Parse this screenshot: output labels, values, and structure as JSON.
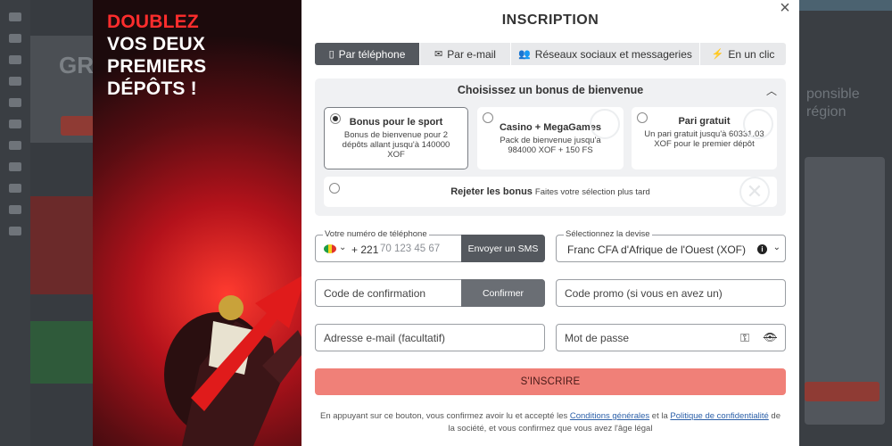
{
  "background": {
    "left_text": "GR",
    "right_text": "ponsible région"
  },
  "promo": {
    "highlight": "DOUBLEZ",
    "rest": "VOS DEUX\nPREMIERS\nDÉPÔTS !"
  },
  "modal": {
    "title": "INSCRIPTION",
    "close_icon": "close-icon"
  },
  "tabs": [
    {
      "label": "Par téléphone",
      "icon": "phone-icon",
      "active": true
    },
    {
      "label": "Par e-mail",
      "icon": "envelope-icon",
      "active": false
    },
    {
      "label": "Réseaux sociaux et messageries",
      "icon": "users-icon",
      "active": false
    },
    {
      "label": "En un clic",
      "icon": "bolt-icon",
      "active": false
    }
  ],
  "bonus": {
    "heading": "Choisissez un bonus de bienvenue",
    "options": [
      {
        "title": "Bonus pour le sport",
        "desc": "Bonus de bienvenue pour 2 dépôts allant jusqu'à 140000 XOF",
        "selected": true
      },
      {
        "title": "Casino + MegaGames",
        "desc": "Pack de bienvenue jusqu'à 984000 XOF + 150 FS",
        "selected": false
      },
      {
        "title": "Pari gratuit",
        "desc": "Un pari gratuit jusqu'à 60331.03 XOF pour le premier dépôt",
        "selected": false
      }
    ],
    "reject_title": "Rejeter les bonus",
    "reject_hint": "Faites votre sélection plus tard"
  },
  "form": {
    "phone_label": "Votre numéro de téléphone",
    "phone_code": "+ 221",
    "phone_placeholder": "70 123 45 67",
    "sms_button": "Envoyer un SMS",
    "currency_label": "Sélectionnez la devise",
    "currency_value": "Franc CFA d'Afrique de l'Ouest (XOF)",
    "confirm_placeholder": "Code de confirmation",
    "confirm_button": "Confirmer",
    "promo_placeholder": "Code promo (si vous en avez un)",
    "email_placeholder": "Adresse e-mail (facultatif)",
    "password_placeholder": "Mot de passe",
    "submit": "S'INSCRIRE"
  },
  "legal": {
    "part1": "En appuyant sur ce bouton, vous confirmez avoir lu et accepté les ",
    "link1": "Conditions générales",
    "part2": " et la ",
    "link2": "Politique de confidentialité",
    "part3": " de la société, et vous confirmez que vous avez l'âge légal"
  },
  "colors": {
    "accent": "#f08078",
    "active_tab": "#54585e",
    "promo_red": "#ff2d2d",
    "link": "#2b5fa8"
  }
}
